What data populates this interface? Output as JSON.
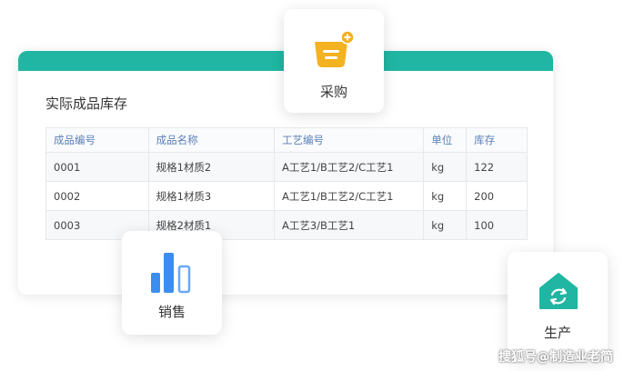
{
  "card": {
    "title": "实际成品库存",
    "accent_color": "#20b6a3"
  },
  "table": {
    "headers": [
      "成品编号",
      "成品名称",
      "工艺编号",
      "单位",
      "库存"
    ],
    "rows": [
      [
        "0001",
        "规格1材质2",
        "A工艺1/B工艺2/C工艺1",
        "kg",
        "122"
      ],
      [
        "0002",
        "规格1材质3",
        "A工艺1/B工艺2/C工艺1",
        "kg",
        "200"
      ],
      [
        "0003",
        "规格2材质1",
        "A工艺3/B工艺1",
        "kg",
        "100"
      ]
    ]
  },
  "modules": {
    "purchase": {
      "label": "采购",
      "icon": "basket-plus-icon",
      "color": "#f3b21f"
    },
    "sales": {
      "label": "销售",
      "icon": "bar-chart-icon",
      "color": "#3b8ef0"
    },
    "production": {
      "label": "生产",
      "icon": "house-refresh-icon",
      "color": "#20b6a3"
    }
  },
  "watermark": "搜狐号@制造业老简"
}
